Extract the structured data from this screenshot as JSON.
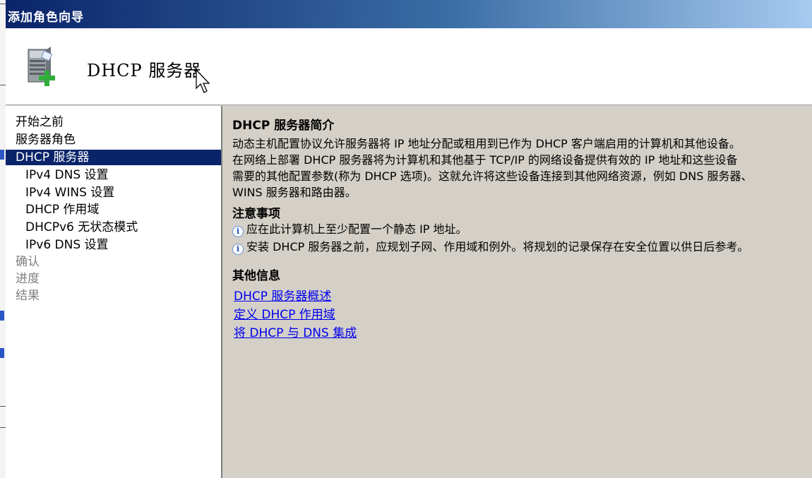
{
  "window": {
    "title": "添加角色向导"
  },
  "header": {
    "title": "DHCP 服务器",
    "icon": "server-add-icon"
  },
  "nav": {
    "items": [
      {
        "label": "开始之前",
        "state": "normal"
      },
      {
        "label": "服务器角色",
        "state": "normal"
      },
      {
        "label": "DHCP 服务器",
        "state": "selected"
      },
      {
        "label": "IPv4 DNS 设置",
        "state": "sub"
      },
      {
        "label": "IPv4 WINS 设置",
        "state": "sub"
      },
      {
        "label": "DHCP 作用域",
        "state": "sub"
      },
      {
        "label": "DHCPv6 无状态模式",
        "state": "sub"
      },
      {
        "label": "IPv6 DNS 设置",
        "state": "sub"
      },
      {
        "label": "确认",
        "state": "disabled"
      },
      {
        "label": "进度",
        "state": "disabled"
      },
      {
        "label": "结果",
        "state": "disabled"
      }
    ]
  },
  "content": {
    "intro_title": "DHCP 服务器简介",
    "intro_lines": [
      "动态主机配置协议允许服务器将 IP 地址分配或租用到已作为 DHCP 客户端启用的计算机和其他设备。",
      "在网络上部署 DHCP 服务器将为计算机和其他基于 TCP/IP 的网络设备提供有效的 IP 地址和这些设备",
      "需要的其他配置参数(称为 DHCP 选项)。这就允许将这些设备连接到其他网络资源，例如 DNS 服务器、",
      "WINS 服务器和路由器。"
    ],
    "notes_title": "注意事项",
    "notes": [
      "应在此计算机上至少配置一个静态 IP 地址。",
      "安装 DHCP 服务器之前，应规划子网、作用域和例外。将规划的记录保存在安全位置以供日后参考。"
    ],
    "more_title": "其他信息",
    "links": [
      "DHCP 服务器概述",
      "定义 DHCP 作用域",
      "将 DHCP 与 DNS 集成"
    ]
  },
  "colors": {
    "titlebar_start": "#0a246a",
    "titlebar_end": "#a6caf0",
    "selection": "#0a246a",
    "panel": "#d4d0c8",
    "link": "#0000ee"
  }
}
